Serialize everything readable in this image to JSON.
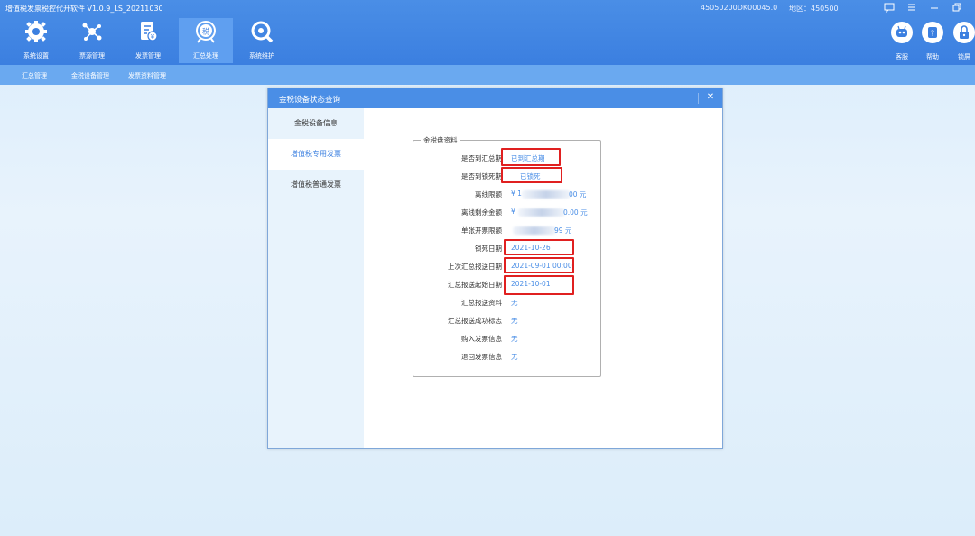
{
  "app": {
    "title": "增值税发票税控代开软件  V1.0.9_LS_20211030",
    "machine_id": "45050200DK00045.0",
    "region": "地区：450500"
  },
  "nav": [
    {
      "label": "系统设置",
      "icon": "gear-icon"
    },
    {
      "label": "票源管理",
      "icon": "network-icon"
    },
    {
      "label": "发票管理",
      "icon": "invoice-icon"
    },
    {
      "label": "汇总处理",
      "icon": "tax-icon",
      "active": true
    },
    {
      "label": "系统维护",
      "icon": "wrench-icon"
    }
  ],
  "right_tools": [
    {
      "label": "客服",
      "icon": "robot-icon"
    },
    {
      "label": "帮助",
      "icon": "help-icon"
    },
    {
      "label": "锁屏",
      "icon": "lock-icon"
    }
  ],
  "subnav": [
    "汇总管理",
    "金税设备管理",
    "发票资料管理"
  ],
  "dialog": {
    "title": "金税设备状态查询",
    "tabs": [
      {
        "label": "金税设备信息"
      },
      {
        "label": "增值税专用发票",
        "active": true
      },
      {
        "label": "增值税普通发票"
      }
    ],
    "group_title": "金税盘资料",
    "rows": [
      {
        "label": "是否到汇总期",
        "value": "已到汇总期"
      },
      {
        "label": "是否到锁死期",
        "value": "已锁死"
      },
      {
        "label": "离线限额",
        "value_prefix": "¥ 1",
        "value_suffix": "00 元"
      },
      {
        "label": "离线剩余金额",
        "value_prefix": "¥",
        "value_suffix": "0.00 元"
      },
      {
        "label": "单张开票限额",
        "value_prefix": "",
        "value_suffix": "99 元"
      },
      {
        "label": "锁死日期",
        "value": "2021-10-26"
      },
      {
        "label": "上次汇总报送日期",
        "value": "2021-09-01 00:00"
      },
      {
        "label": "汇总报送起始日期",
        "value": "2021-10-01"
      },
      {
        "label": "汇总报送资料",
        "value": "无"
      },
      {
        "label": "汇总报送成功标志",
        "value": "无"
      },
      {
        "label": "购入发票信息",
        "value": "无"
      },
      {
        "label": "退回发票信息",
        "value": "无"
      }
    ]
  },
  "colors": {
    "topbar": "#3b7fe0",
    "subnav": "#6aa9f0",
    "accent": "#4a8ee6",
    "highlight": "#e02020"
  }
}
